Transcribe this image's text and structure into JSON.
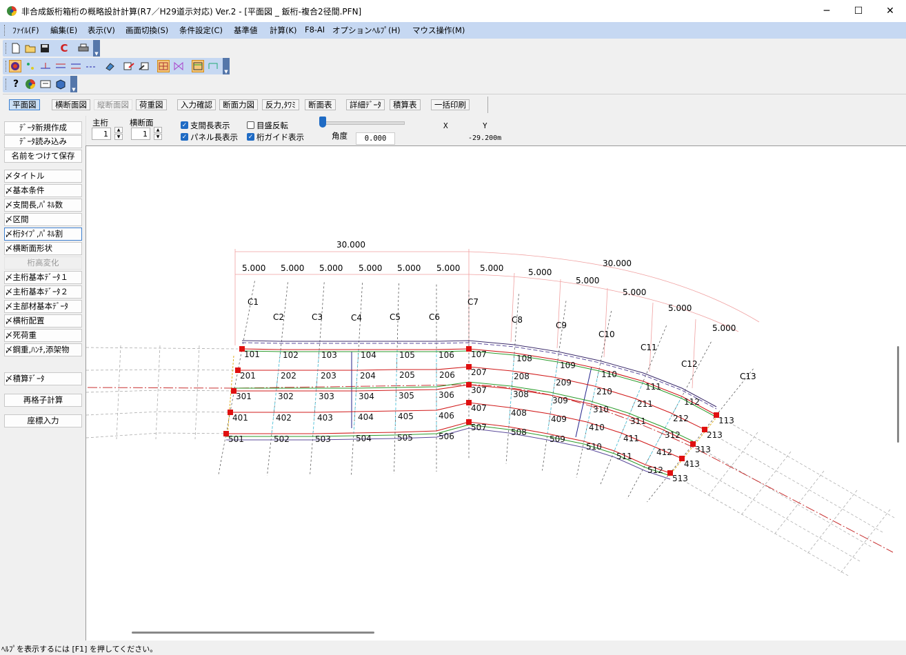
{
  "window": {
    "title": "非合成鈑桁箱桁の概略設計計算(R7／H29道示対応) Ver.2 - [平面図 _ 鈑桁-複合2径間.PFN]",
    "minimize": "─",
    "maximize": "☐",
    "close": "✕"
  },
  "menu": [
    "ﾌｧｲﾙ(F)",
    "編集(E)",
    "表示(V)",
    "画面切換(S)",
    "条件設定(C)",
    "基準値",
    "計算(K)",
    "F8-AI",
    "オプション",
    "ﾍﾙﾌﾟ(H)",
    "マウス操作(M)"
  ],
  "tabs": [
    {
      "label": "平面図",
      "state": "active"
    },
    {
      "label": "横断面図",
      "state": "normal"
    },
    {
      "label": "縦断面図",
      "state": "disabled"
    },
    {
      "label": "荷重図",
      "state": "normal"
    },
    {
      "label": "入力確認",
      "state": "normal"
    },
    {
      "label": "断面力図",
      "state": "normal"
    },
    {
      "label": "反力,ﾀﾜﾐ",
      "state": "normal"
    },
    {
      "label": "断面表",
      "state": "normal"
    },
    {
      "label": "詳細ﾃﾞｰﾀ",
      "state": "normal"
    },
    {
      "label": "積算表",
      "state": "normal"
    },
    {
      "label": "一括印刷",
      "state": "normal"
    }
  ],
  "sidebar": [
    {
      "label": "ﾃﾞｰﾀ新規作成",
      "style": "center"
    },
    {
      "label": "ﾃﾞｰﾀ読み込み",
      "style": "center"
    },
    {
      "label": "名前をつけて保存",
      "style": "center"
    },
    {
      "label": "〆タイトル",
      "style": "normal"
    },
    {
      "label": "〆基本条件",
      "style": "normal"
    },
    {
      "label": "〆支間長,ﾊﾟﾈﾙ数",
      "style": "normal"
    },
    {
      "label": "〆区間",
      "style": "normal"
    },
    {
      "label": "〆桁ﾀｲﾌﾟ,ﾊﾟﾈﾙ割",
      "style": "selected"
    },
    {
      "label": "〆横断面形状",
      "style": "normal"
    },
    {
      "label": "桁高変化",
      "style": "disabled"
    },
    {
      "label": "〆主桁基本ﾃﾞｰﾀ１",
      "style": "normal"
    },
    {
      "label": "〆主桁基本ﾃﾞｰﾀ２",
      "style": "normal"
    },
    {
      "label": "〆主部材基本ﾃﾞｰﾀ",
      "style": "normal"
    },
    {
      "label": "〆横桁配置",
      "style": "normal"
    },
    {
      "label": "〆死荷重",
      "style": "normal"
    },
    {
      "label": "〆鋼重,ﾊﾝﾁ,添架物",
      "style": "normal"
    },
    {
      "label": "〆積算ﾃﾞｰﾀ",
      "style": "normal"
    },
    {
      "label": "再格子計算",
      "style": "center"
    },
    {
      "label": "座標入力",
      "style": "center"
    }
  ],
  "controls": {
    "main_girder_label": "主桁",
    "main_girder_value": "1",
    "cross_section_label": "横断面",
    "cross_section_value": "1",
    "chk_span_length": {
      "label": "支間長表示",
      "checked": true
    },
    "chk_panel_length": {
      "label": "パネル長表示",
      "checked": true
    },
    "chk_scale_reverse": {
      "label": "目盛反転",
      "checked": false
    },
    "chk_girder_guide": {
      "label": "桁ガイド表示",
      "checked": true
    },
    "angle_label": "角度",
    "angle_value": "0.000",
    "x_label": "X",
    "y_label": "Y",
    "y_value": "-29.200m",
    "check_mark": "✓"
  },
  "statusbar": "ﾍﾙﾌﾟを表示するには [F1] を押してください。",
  "drawing": {
    "span_labels": [
      "30.000",
      "30.000"
    ],
    "panel_label": "5.000",
    "sections": [
      "C1",
      "C2",
      "C3",
      "C4",
      "C5",
      "C6",
      "C7",
      "C8",
      "C9",
      "C10",
      "C11",
      "C12",
      "C13"
    ],
    "girder_count": 5
  }
}
